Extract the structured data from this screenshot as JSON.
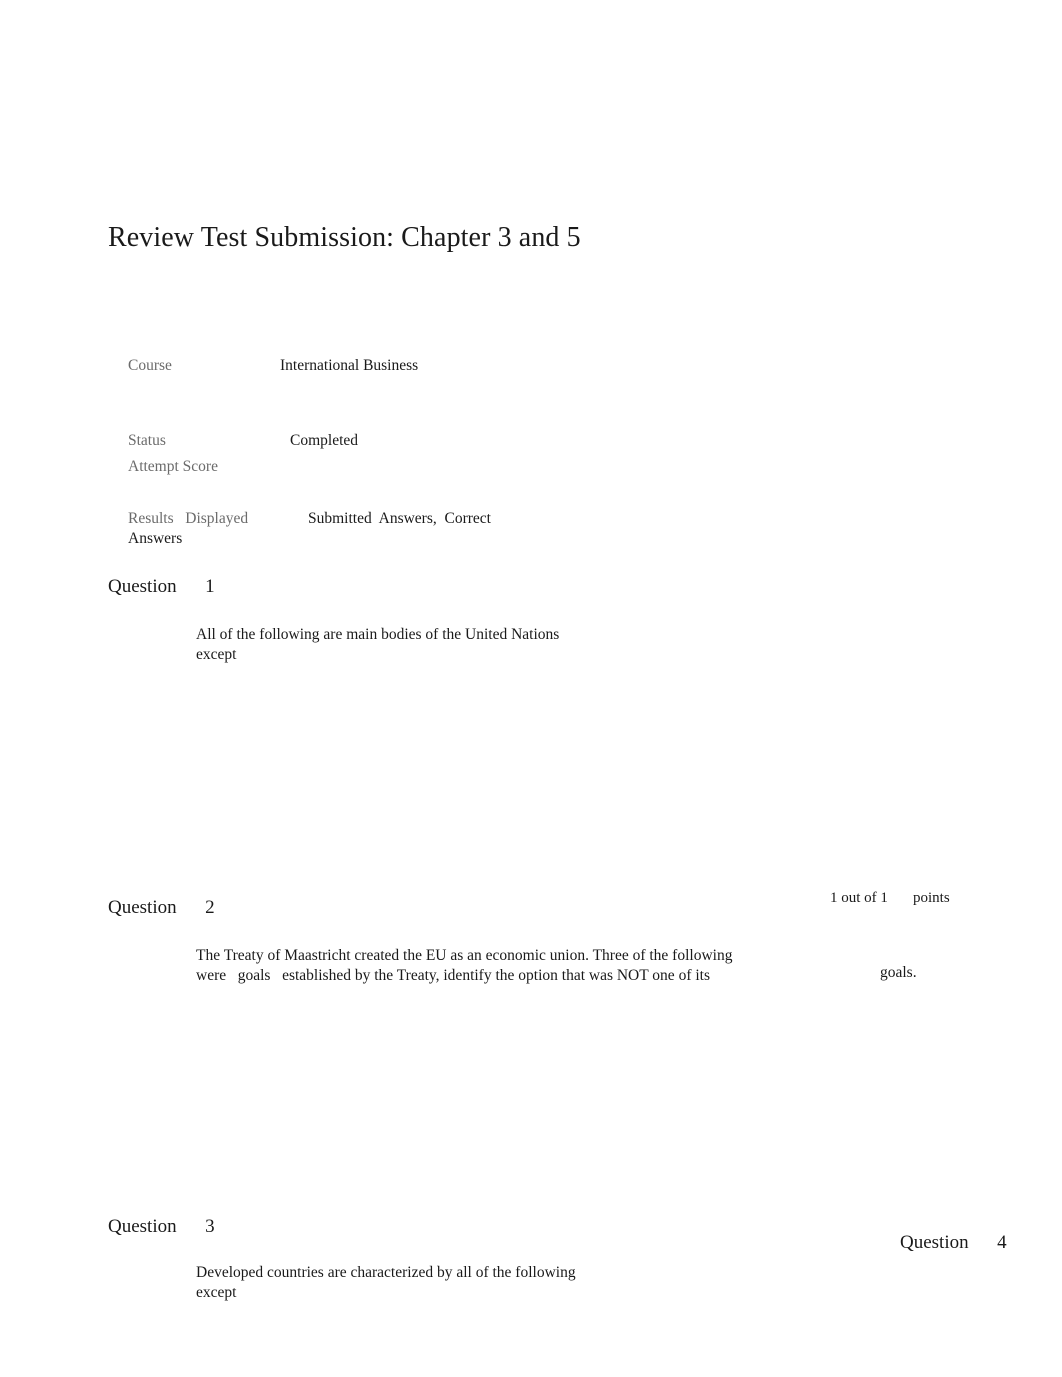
{
  "document": {
    "title": "Review Test Submission: Chapter 3 and 5"
  },
  "metadata": {
    "course": {
      "label": "Course",
      "value": "International Business"
    },
    "status": {
      "label": "Status",
      "value": "Completed"
    },
    "attempt_score": {
      "label": "Attempt Score",
      "value": ""
    },
    "results_displayed": {
      "label": "Results   Displayed",
      "value": "Submitted  Answers,  Correct",
      "value_continued": "Answers"
    }
  },
  "questions": [
    {
      "label": "Question",
      "number": "1",
      "heading": "Question      1",
      "text_line_1": "All of the following are main bodies of the United Nations",
      "text_line_2": "except",
      "points": {
        "score": "",
        "unit": ""
      }
    },
    {
      "label": "Question",
      "number": "2",
      "heading": "Question      2",
      "text_line_1": "The Treaty of Maastricht created the EU as an economic union. Three of the following",
      "text_line_2": "were   goals   established by the Treaty, identify the option that was NOT one of its",
      "text_tail": "goals.",
      "points": {
        "score": "1 out of 1",
        "unit": "points"
      }
    },
    {
      "label": "Question",
      "number": "3",
      "heading": "Question      3",
      "text_line_1": "Developed countries are characterized by all of the following",
      "text_line_2": "except",
      "points": {
        "score": "",
        "unit": ""
      }
    },
    {
      "label": "Question",
      "number": "4",
      "heading": "Question      4",
      "text_line_1": "",
      "text_line_2": "",
      "points": {
        "score": "",
        "unit": ""
      }
    }
  ],
  "colors": {
    "page_background": "#ffffff",
    "body_text": "#1a1a1a",
    "meta_label_text": "#6b6b6b"
  }
}
